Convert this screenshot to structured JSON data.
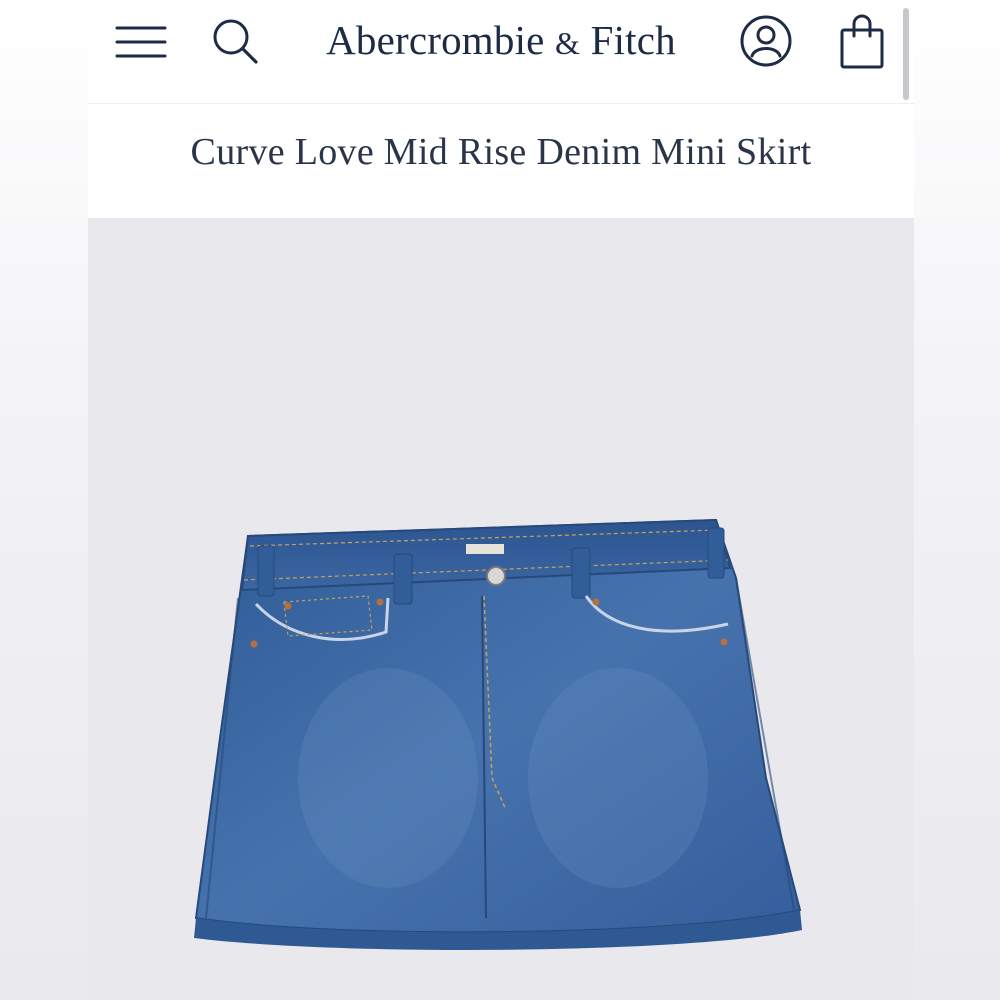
{
  "header": {
    "brand_main": "Abercrombie",
    "brand_amp": "&",
    "brand_tail": "Fitch",
    "icons": {
      "menu": "hamburger-menu-icon",
      "search": "search-icon",
      "account": "account-user-icon",
      "bag": "shopping-bag-icon"
    }
  },
  "product": {
    "title": "Curve Love Mid Rise Denim Mini Skirt",
    "image_subject": "denim-mini-skirt"
  },
  "colors": {
    "brand_navy": "#1d2b45",
    "title_text": "#2b3549",
    "gallery_bg": "#e9e8ed",
    "denim": "#3f6ba6"
  }
}
